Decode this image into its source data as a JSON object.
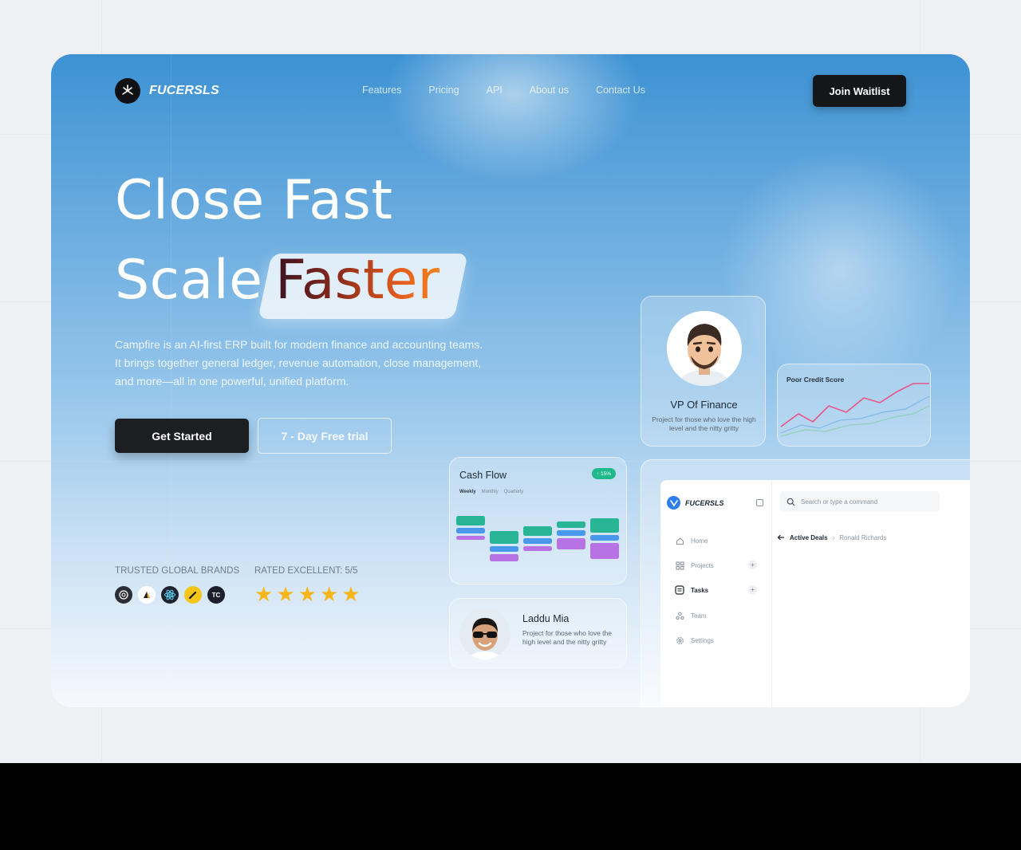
{
  "brand": {
    "name": "FUCERSLS"
  },
  "nav": {
    "items": [
      "Features",
      "Pricing",
      "API",
      "About us",
      "Contact Us"
    ],
    "cta": "Join Waitlist"
  },
  "hero": {
    "line1": "Close Fast",
    "line2_plain": "Scale",
    "line2_highlight": "Faster",
    "description": "Campfire is an AI-first ERP built for modern finance and accounting teams. It brings together general ledger, revenue automation, close management, and more—all in one powerful, unified platform.",
    "primary_cta": "Get Started",
    "secondary_cta": "7 - Day Free trial"
  },
  "social_proof": {
    "trusted_label": "TRUSTED GLOBAL BRANDS",
    "brand_icons": [
      "openai-icon",
      "arrow-logo-icon",
      "react-icon",
      "pen-logo-icon",
      "tc-logo-icon"
    ],
    "rated_label": "RATED EXCELLENT: 5/5",
    "rating": 5
  },
  "vp_card": {
    "title": "VP Of Finance",
    "subtitle": "Project for those who love the high level and the nitty gritty"
  },
  "credit_card": {
    "title": "Poor Credit Score",
    "series_colors": [
      "#e8558a",
      "#7fb8e8",
      "#8fd0b6"
    ]
  },
  "cash_flow": {
    "title": "Cash Flow",
    "badge": "↑ 15%",
    "tabs": [
      "Weekly",
      "Monthly",
      "Quarterly"
    ],
    "colors": {
      "green": "#27b596",
      "blue": "#4a98ec",
      "purple": "#b772e4"
    }
  },
  "profile_card": {
    "name": "Laddu Mia",
    "subtitle": "Project for those who love the high level and the nitty gritty"
  },
  "dashboard": {
    "brand": "FUCERSLS",
    "search_placeholder": "Search or type a command",
    "menu": [
      {
        "label": "Home",
        "icon": "home-icon"
      },
      {
        "label": "Projects",
        "icon": "grid-icon"
      },
      {
        "label": "Tasks",
        "icon": "tasks-icon"
      },
      {
        "label": "Team",
        "icon": "team-icon"
      },
      {
        "label": "Settings",
        "icon": "settings-icon"
      }
    ],
    "breadcrumb": {
      "current": "Active Deals",
      "sub": "Ronald Richards"
    }
  }
}
